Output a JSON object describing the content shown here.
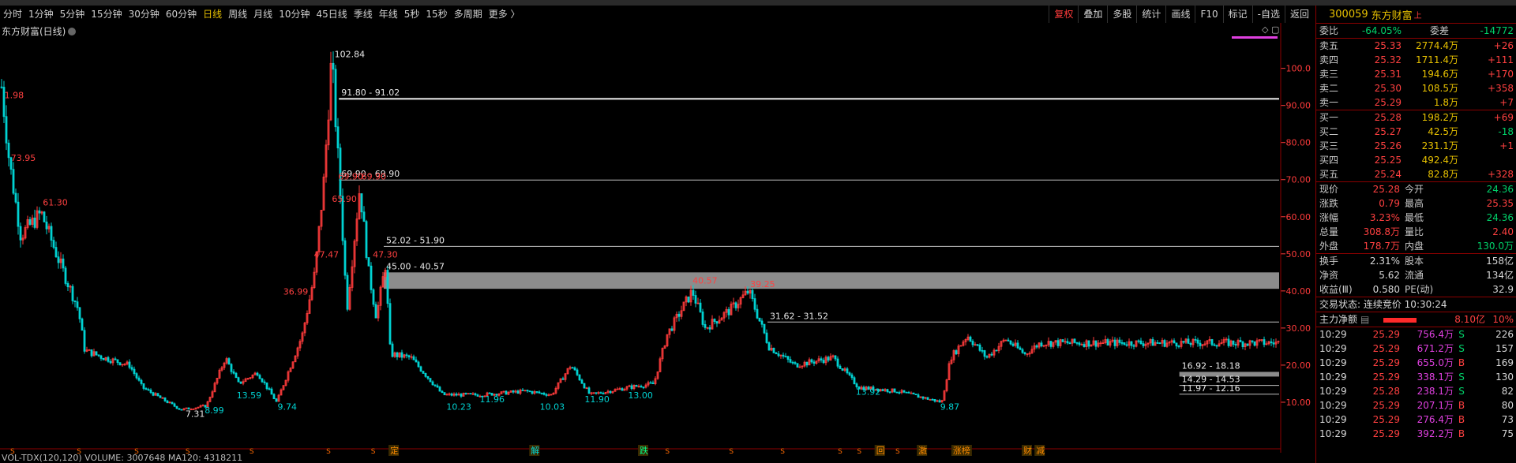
{
  "toolbar": {
    "periods": [
      "分时",
      "1分钟",
      "5分钟",
      "15分钟",
      "30分钟",
      "60分钟",
      "日线",
      "周线",
      "月线",
      "10分钟",
      "45日线",
      "季线",
      "年线",
      "5秒",
      "15秒",
      "多周期",
      "更多 〉"
    ],
    "active_period": "日线",
    "actions": [
      "复权",
      "叠加",
      "多股",
      "统计",
      "画线",
      "F10",
      "标记",
      "-自选",
      "返回"
    ]
  },
  "chart": {
    "title": "东方财富(日线)",
    "volume_label_prefix": "VOL-TDX(120,120) VOLUME: 3007648 MA120: 4318211",
    "volume_label_ma": "MA120: 4318211",
    "price_axis": [
      "100.0",
      "90.00",
      "80.00",
      "70.00",
      "60.00",
      "50.00",
      "40.00",
      "30.00",
      "20.00",
      "10.00"
    ],
    "zones": [
      {
        "label": "91.80 - 91.02",
        "lo": 91.02,
        "hi": 91.8,
        "x1": 0.265,
        "kind": "line"
      },
      {
        "label": "69.90 - 69.90",
        "lo": 69.9,
        "hi": 69.9,
        "x1": 0.265,
        "kind": "line"
      },
      {
        "label": "52.02 - 51.90",
        "lo": 51.9,
        "hi": 52.02,
        "x1": 0.3,
        "kind": "line"
      },
      {
        "label": "45.00 - 40.57",
        "lo": 40.57,
        "hi": 45.0,
        "x1": 0.3,
        "kind": "band"
      },
      {
        "label": "31.62 - 31.52",
        "lo": 31.52,
        "hi": 31.62,
        "x1": 0.6,
        "kind": "line"
      },
      {
        "label": "16.92 - 18.18",
        "lo": 16.92,
        "hi": 18.18,
        "x1": 0.922,
        "kind": "band"
      },
      {
        "label": "14.29 - 14.53",
        "lo": 14.29,
        "hi": 14.53,
        "x1": 0.922,
        "kind": "line"
      },
      {
        "label": "11.97 - 12.16",
        "lo": 11.97,
        "hi": 12.16,
        "x1": 0.922,
        "kind": "line"
      }
    ],
    "high_labels": [
      {
        "text": "1.98",
        "x": 0.001,
        "v": 92
      },
      {
        "text": "73.95",
        "x": 0.006,
        "v": 75
      },
      {
        "text": "61.30",
        "x": 0.031,
        "v": 63
      },
      {
        "text": "102.84",
        "x": 0.259,
        "v": 103
      },
      {
        "text": "69.90",
        "x": 0.262,
        "v": 70
      },
      {
        "text": "69.90",
        "x": 0.28,
        "v": 70
      },
      {
        "text": "65.90",
        "x": 0.257,
        "v": 64
      },
      {
        "text": "47.47",
        "x": 0.243,
        "v": 49
      },
      {
        "text": "47.30",
        "x": 0.289,
        "v": 49
      },
      {
        "text": "36.99",
        "x": 0.219,
        "v": 39
      },
      {
        "text": "40.57",
        "x": 0.539,
        "v": 42
      },
      {
        "text": "39.25",
        "x": 0.584,
        "v": 41
      }
    ],
    "low_labels": [
      {
        "text": "7.31",
        "x": 0.145,
        "v": 9
      },
      {
        "text": "8.99",
        "x": 0.16,
        "v": 10
      },
      {
        "text": "13.59",
        "x": 0.185,
        "v": 14
      },
      {
        "text": "9.74",
        "x": 0.217,
        "v": 11
      },
      {
        "text": "10.23",
        "x": 0.349,
        "v": 11
      },
      {
        "text": "11.96",
        "x": 0.375,
        "v": 13
      },
      {
        "text": "10.03",
        "x": 0.422,
        "v": 11
      },
      {
        "text": "11.90",
        "x": 0.457,
        "v": 13
      },
      {
        "text": "13.00",
        "x": 0.491,
        "v": 14
      },
      {
        "text": "13.92",
        "x": 0.669,
        "v": 15
      },
      {
        "text": "9.87",
        "x": 0.735,
        "v": 11
      }
    ],
    "event_markers": [
      "S",
      "S",
      "S",
      "S",
      "S",
      "S",
      "S",
      "定",
      "解",
      "跌",
      "S",
      "S",
      "S",
      "S",
      "S",
      "S",
      "回",
      "激",
      "涨榜",
      "财",
      "减"
    ]
  },
  "quote": {
    "code": "300059",
    "name": "东方财富",
    "exchange_mark": "上",
    "weibi_label": "委比",
    "weibi": "-64.05%",
    "weicha_label": "委差",
    "weicha": "-14772",
    "asks": [
      {
        "label": "卖五",
        "price": "25.33",
        "vol": "2774.4万",
        "chg": "+26"
      },
      {
        "label": "卖四",
        "price": "25.32",
        "vol": "1711.4万",
        "chg": "+111"
      },
      {
        "label": "卖三",
        "price": "25.31",
        "vol": "194.6万",
        "chg": "+170"
      },
      {
        "label": "卖二",
        "price": "25.30",
        "vol": "108.5万",
        "chg": "+358"
      },
      {
        "label": "卖一",
        "price": "25.29",
        "vol": "1.8万",
        "chg": "+7"
      }
    ],
    "bids": [
      {
        "label": "买一",
        "price": "25.28",
        "vol": "198.2万",
        "chg": "+69"
      },
      {
        "label": "买二",
        "price": "25.27",
        "vol": "42.5万",
        "chg": "-18"
      },
      {
        "label": "买三",
        "price": "25.26",
        "vol": "231.1万",
        "chg": "+1"
      },
      {
        "label": "买四",
        "price": "25.25",
        "vol": "492.4万",
        "chg": ""
      },
      {
        "label": "买五",
        "price": "25.24",
        "vol": "82.8万",
        "chg": "+328"
      }
    ],
    "stats": [
      [
        "现价",
        "25.28",
        "今开",
        "24.36"
      ],
      [
        "涨跌",
        "0.79",
        "最高",
        "25.35"
      ],
      [
        "涨幅",
        "3.23%",
        "最低",
        "24.36"
      ],
      [
        "总量",
        "308.8万",
        "量比",
        "2.40"
      ],
      [
        "外盘",
        "178.7万",
        "内盘",
        "130.0万"
      ]
    ],
    "stats2": [
      [
        "换手",
        "2.31%",
        "股本",
        "158亿"
      ],
      [
        "净资",
        "5.62",
        "流通",
        "134亿"
      ],
      [
        "收益(Ⅲ)",
        "0.580",
        "PE(动)",
        "32.9"
      ]
    ],
    "trade_status": "交易状态: 连续竞价 10:30:24",
    "main_flow_label": "主力净额",
    "main_flow_value": "8.10亿",
    "main_flow_pct": "10%",
    "ticks": [
      {
        "t": "10:29",
        "p": "25.29",
        "v": "756.4万",
        "s": "S",
        "n": "226"
      },
      {
        "t": "10:29",
        "p": "25.29",
        "v": "671.2万",
        "s": "S",
        "n": "157"
      },
      {
        "t": "10:29",
        "p": "25.29",
        "v": "655.0万",
        "s": "B",
        "n": "169"
      },
      {
        "t": "10:29",
        "p": "25.29",
        "v": "338.1万",
        "s": "S",
        "n": "130"
      },
      {
        "t": "10:29",
        "p": "25.28",
        "v": "238.1万",
        "s": "S",
        "n": "82"
      },
      {
        "t": "10:29",
        "p": "25.29",
        "v": "207.1万",
        "s": "B",
        "n": "80"
      },
      {
        "t": "10:29",
        "p": "25.29",
        "v": "276.4万",
        "s": "B",
        "n": "73"
      },
      {
        "t": "10:29",
        "p": "25.29",
        "v": "392.2万",
        "s": "B",
        "n": "75"
      }
    ]
  },
  "colors": {
    "up": "#ff3b3b",
    "down": "#00d2d2",
    "accent": "#e6c000",
    "border": "#8b0000"
  }
}
